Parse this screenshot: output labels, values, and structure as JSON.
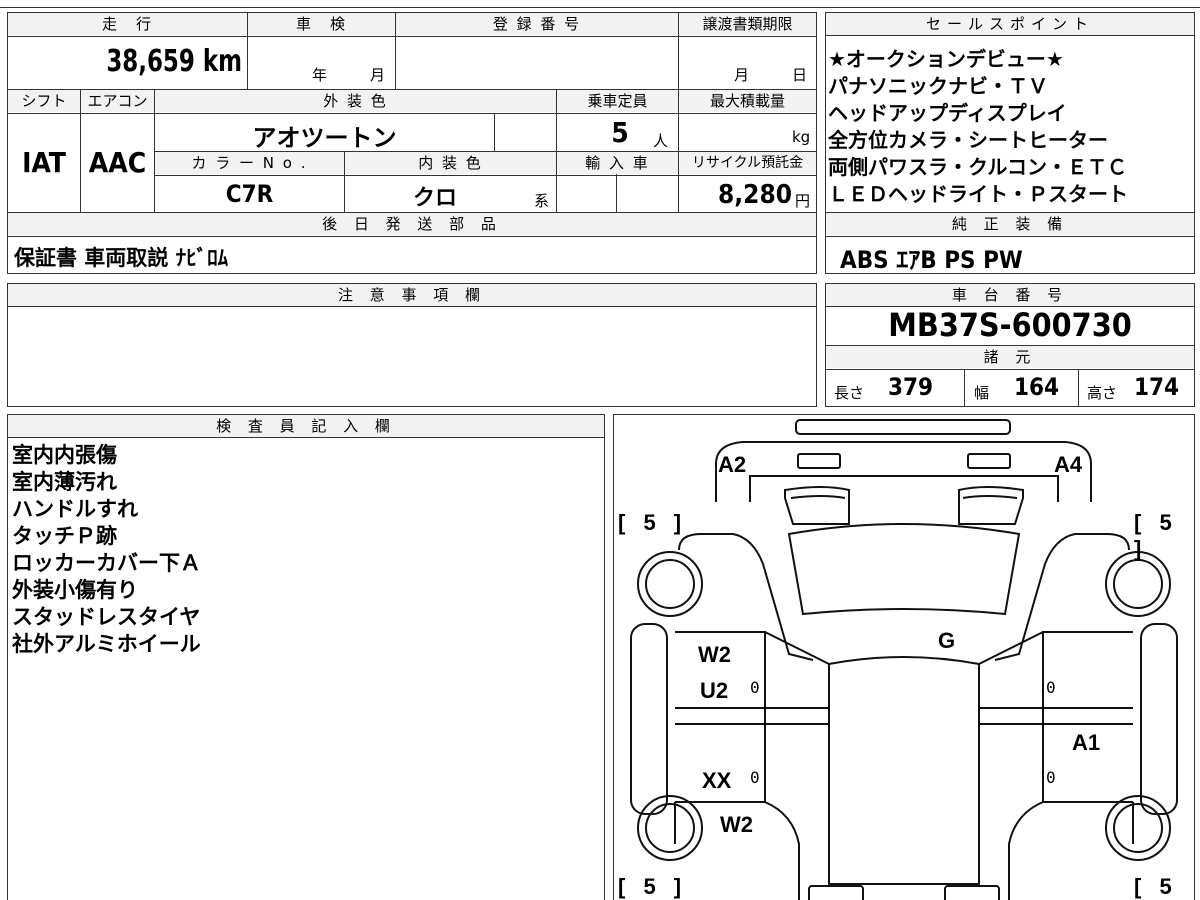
{
  "top_strip": "",
  "vehicle": {
    "mileage_header": "走　行",
    "mileage": "38,659 km",
    "inspection_header": "車　検",
    "inspection_year": "年",
    "inspection_month": "月",
    "registration_header": "登 録 番 号",
    "transfer_header": "譲渡書類期限",
    "transfer_month": "月",
    "transfer_day": "日",
    "shift_header": "シフト",
    "shift": "IAT",
    "ac_header": "エアコン",
    "ac": "AAC",
    "exterior_header": "外 装 色",
    "exterior_color": "アオツートン",
    "color_no_header": "カ ラ ー N o .",
    "color_no": "C7R",
    "interior_header": "内 装 色",
    "interior_color": "クロ",
    "interior_suffix": "系",
    "capacity_header": "乗車定員",
    "capacity": "5",
    "capacity_unit": "人",
    "max_load_header": "最大積載量",
    "max_load_unit": "kg",
    "import_header": "輸 入 車",
    "recycle_header": "リサイクル預託金",
    "recycle_fee": "8,280",
    "recycle_unit": "円",
    "later_parts_header": "後 日 発 送 部 品",
    "later_parts": "保証書 車両取説 ﾅﾋﾞﾛﾑ"
  },
  "sales_points": {
    "header": "セールスポイント",
    "lines": [
      "★オークションデビュー★",
      "パナソニックナビ・ＴＶ",
      "ヘッドアップディスプレイ",
      "全方位カメラ・シートヒーター",
      "両側パワスラ・クルコン・ＥＴＣ",
      "ＬＥＤヘッドライト・Ｐスタート"
    ]
  },
  "equipment": {
    "header": "純 正 装 備",
    "value": "ABS ｴｱB PS PW"
  },
  "notes": {
    "header": "注 意 事 項 欄",
    "value": ""
  },
  "chassis": {
    "header": "車 台 番 号",
    "value": "MB37S-600730"
  },
  "specs": {
    "header": "諸 元",
    "length_label": "長さ",
    "length": "379",
    "width_label": "幅",
    "width": "164",
    "height_label": "高さ",
    "height": "174"
  },
  "inspector": {
    "header": "検 査 員 記 入 欄",
    "lines": [
      "室内内張傷",
      "室内薄汚れ",
      "ハンドルすれ",
      "タッチＰ跡",
      "ロッカーカバー下Ａ",
      "外装小傷有り",
      "スタッドレスタイヤ",
      "社外アルミホイール"
    ]
  },
  "diagram": {
    "marks": {
      "front_left": "A2",
      "front_right": "A4",
      "windshield": "G",
      "left_front_door": "W2",
      "left_front_door_2": "U2",
      "left_rear_door": "XX",
      "left_rear_fender": "W2",
      "right_rear_door": "A1"
    },
    "tire_tl": "[ 5 ]",
    "tire_tr": "[ 5 ]",
    "tire_bl": "[ 5 ]",
    "tire_br": "[ 5 ]",
    "zero_1": "0",
    "zero_2": "0",
    "zero_3": "0",
    "zero_4": "0"
  }
}
